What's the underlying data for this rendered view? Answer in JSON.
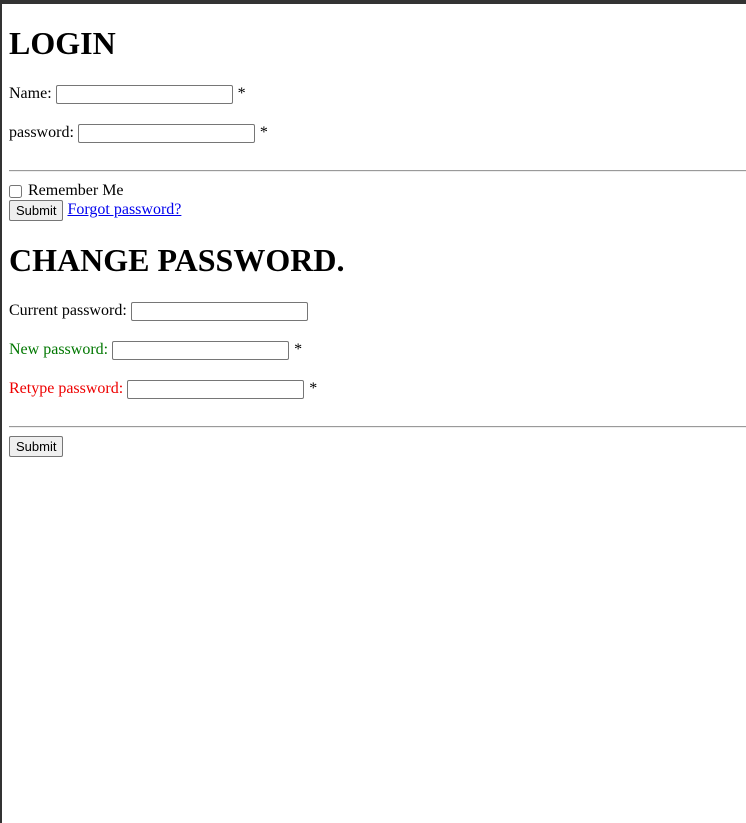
{
  "login": {
    "title": "LOGIN",
    "name_label": "Name:",
    "name_value": "",
    "password_label": "password:",
    "password_value": "",
    "required_mark": "*",
    "remember_label": "Remember Me",
    "remember_checked": false,
    "submit_label": "Submit",
    "forgot_link": "Forgot password?"
  },
  "change_password": {
    "title": "CHANGE PASSWORD.",
    "current_label": "Current password:",
    "new_label": "New password:",
    "retype_label": "Retype password:",
    "required_mark": "*",
    "submit_label": "Submit"
  },
  "colors": {
    "new_label": "#007700",
    "retype_label": "#ee0000",
    "link": "#0000ee"
  }
}
